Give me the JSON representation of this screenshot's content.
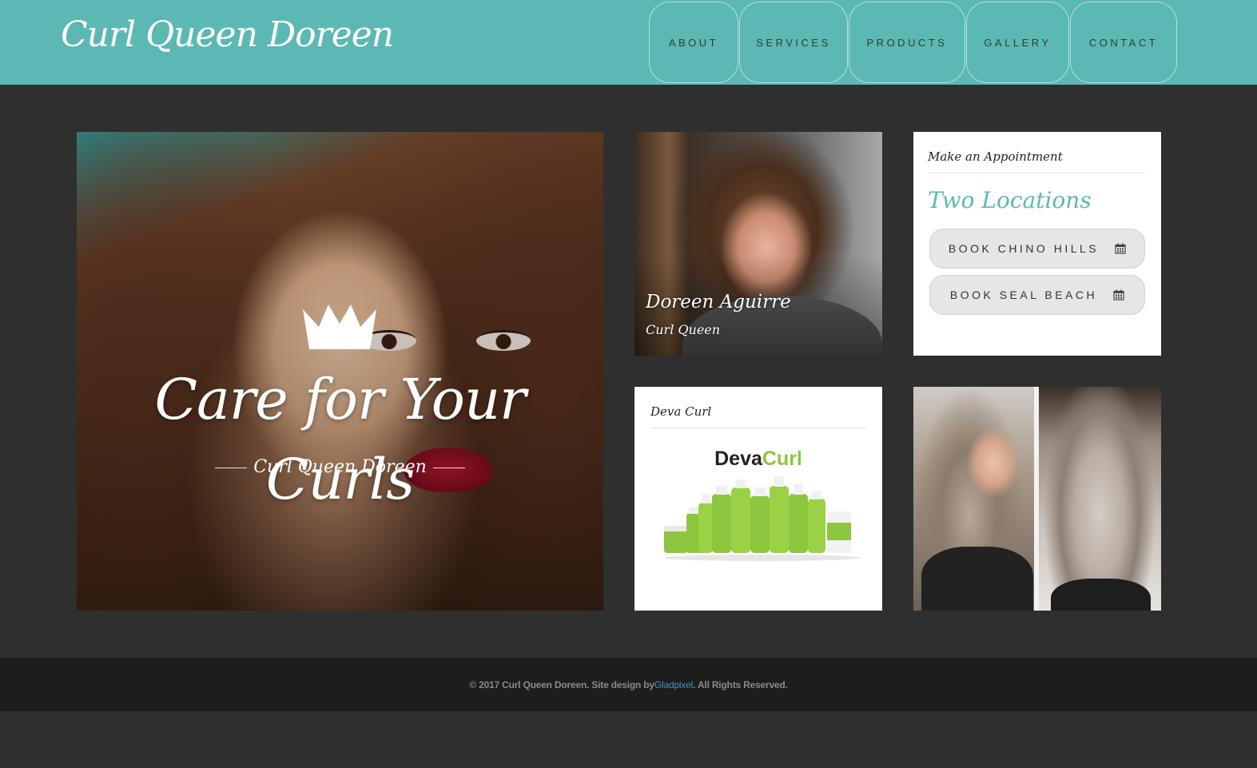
{
  "brand": {
    "name": "Curl Queen Doreen"
  },
  "nav": [
    {
      "label": "ABOUT"
    },
    {
      "label": "SERVICES"
    },
    {
      "label": "PRODUCTS"
    },
    {
      "label": "GALLERY"
    },
    {
      "label": "CONTACT"
    }
  ],
  "hero": {
    "title": "Care for Your Curls",
    "subtitle": "Curl Queen Doreen",
    "crown_icon": "crown-icon"
  },
  "profile": {
    "name": "Doreen Aguirre",
    "role": "Curl Queen"
  },
  "appointment": {
    "title": "Make an Appointment",
    "heading": "Two Locations",
    "buttons": [
      {
        "label": "BOOK CHINO HILLS",
        "icon": "calendar-icon"
      },
      {
        "label": "BOOK SEAL BEACH",
        "icon": "calendar-icon"
      }
    ]
  },
  "product_card": {
    "title": "Deva Curl",
    "logo_part1": "Deva",
    "logo_part2": "Curl"
  },
  "footer": {
    "prefix": "© 2017 Curl Queen Doreen. Site design by ",
    "link": "Gladpixel",
    "suffix": ". All Rights Reserved."
  },
  "colors": {
    "header_teal": "#5cb8b2",
    "page_bg": "#2f2f2f",
    "footer_bg": "#1d1d1d",
    "accent_green": "#8dc63f",
    "link_blue": "#4a8fc0"
  }
}
